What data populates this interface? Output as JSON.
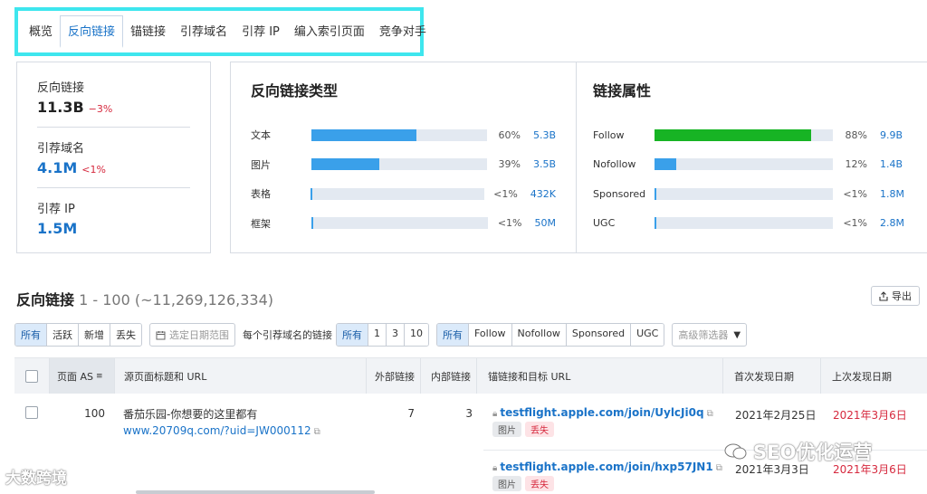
{
  "tabs": [
    "概览",
    "反向链接",
    "锚链接",
    "引荐域名",
    "引荐 IP",
    "编入索引页面",
    "竞争对手"
  ],
  "summary": {
    "backlinks": {
      "label": "反向链接",
      "value": "11.3B",
      "delta": "−3%"
    },
    "ref_domains": {
      "label": "引荐域名",
      "value": "4.1M",
      "delta": "<1%"
    },
    "ref_ips": {
      "label": "引荐 IP",
      "value": "1.5M"
    }
  },
  "backlink_types": {
    "title": "反向链接类型",
    "rows": [
      {
        "label": "文本",
        "percent_text": "60%",
        "value": "5.3B"
      },
      {
        "label": "图片",
        "percent_text": "39%",
        "value": "3.5B"
      },
      {
        "label": "表格",
        "percent_text": "<1%",
        "value": "432K"
      },
      {
        "label": "框架",
        "percent_text": "<1%",
        "value": "50M"
      }
    ]
  },
  "link_attributes": {
    "title": "链接属性",
    "rows": [
      {
        "label": "Follow",
        "percent_text": "88%",
        "value": "9.9B"
      },
      {
        "label": "Nofollow",
        "percent_text": "12%",
        "value": "1.4B"
      },
      {
        "label": "Sponsored",
        "percent_text": "<1%",
        "value": "1.8M"
      },
      {
        "label": "UGC",
        "percent_text": "<1%",
        "value": "2.8M"
      }
    ]
  },
  "chart_data": [
    {
      "type": "bar",
      "title": "反向链接类型",
      "categories": [
        "文本",
        "图片",
        "表格",
        "框架"
      ],
      "values": [
        60,
        39,
        0.5,
        0.5
      ],
      "value_labels": [
        "5.3B",
        "3.5B",
        "432K",
        "50M"
      ],
      "color": "#3aa0ea"
    },
    {
      "type": "bar",
      "title": "链接属性",
      "categories": [
        "Follow",
        "Nofollow",
        "Sponsored",
        "UGC"
      ],
      "values": [
        88,
        12,
        0.5,
        0.5
      ],
      "value_labels": [
        "9.9B",
        "1.4B",
        "1.8M",
        "2.8M"
      ],
      "colors": [
        "#17b424",
        "#3aa0ea",
        "#3aa0ea",
        "#3aa0ea"
      ]
    }
  ],
  "list": {
    "title": "反向链接",
    "range": "1 - 100 (~11,269,126,334)",
    "export_label": "导出"
  },
  "filters": {
    "status": [
      "所有",
      "活跃",
      "新增",
      "丢失"
    ],
    "date_range": "选定日期范围",
    "per_domain_label": "每个引荐域名的链接",
    "per_domain": [
      "所有",
      "1",
      "3",
      "10"
    ],
    "link_type": [
      "所有",
      "Follow",
      "Nofollow",
      "Sponsored",
      "UGC"
    ],
    "advanced": "高级筛选器"
  },
  "table": {
    "headers": [
      "页面 AS",
      "源页面标题和 URL",
      "外部链接",
      "内部链接",
      "锚链接和目标 URL",
      "首次发现日期",
      "上次发现日期"
    ],
    "rows": [
      {
        "as": "100",
        "title": "番茄乐园-你想要的这里都有",
        "url": "www.20709q.com/?uid=JW000112",
        "external": "7",
        "internal": "3",
        "target": "testflight.apple.com/join/UylcJi0q",
        "tags": [
          "图片",
          "丢失"
        ],
        "first_seen": "2021年2月25日",
        "last_seen": "2021年3月6日"
      },
      {
        "target": "testflight.apple.com/join/hxp57JN1",
        "tags": [
          "图片",
          "丢失"
        ],
        "first_seen": "2021年3月3日",
        "last_seen": "2021年3月6日"
      }
    ]
  },
  "watermarks": {
    "left": "大数跨境",
    "right": "SEO优化运营"
  }
}
